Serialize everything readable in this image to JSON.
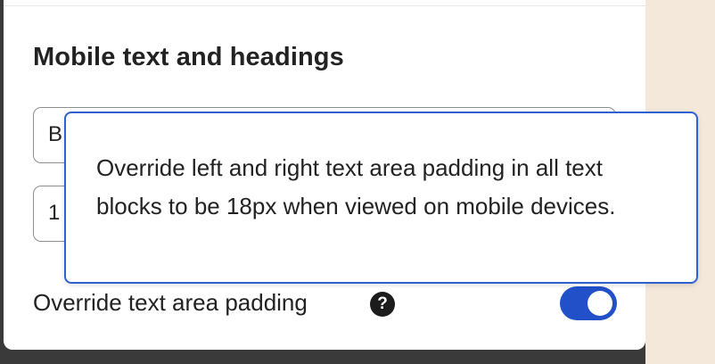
{
  "panel": {
    "section_title": "Mobile text and headings",
    "font_field": {
      "value_visible": "B"
    },
    "size_field": {
      "value_visible": "1"
    },
    "padding_toggle": {
      "label": "Override text area padding",
      "help_icon": "?",
      "state": "on"
    }
  },
  "tooltip": {
    "text": "Override left and right text area padding in all text blocks to be 18px when viewed on mobile devices."
  },
  "colors": {
    "accent": "#2250c8",
    "tooltip_border": "#2f62d0",
    "backdrop_right": "#f3e8da"
  },
  "icons": {
    "help": "question-circle-icon"
  }
}
